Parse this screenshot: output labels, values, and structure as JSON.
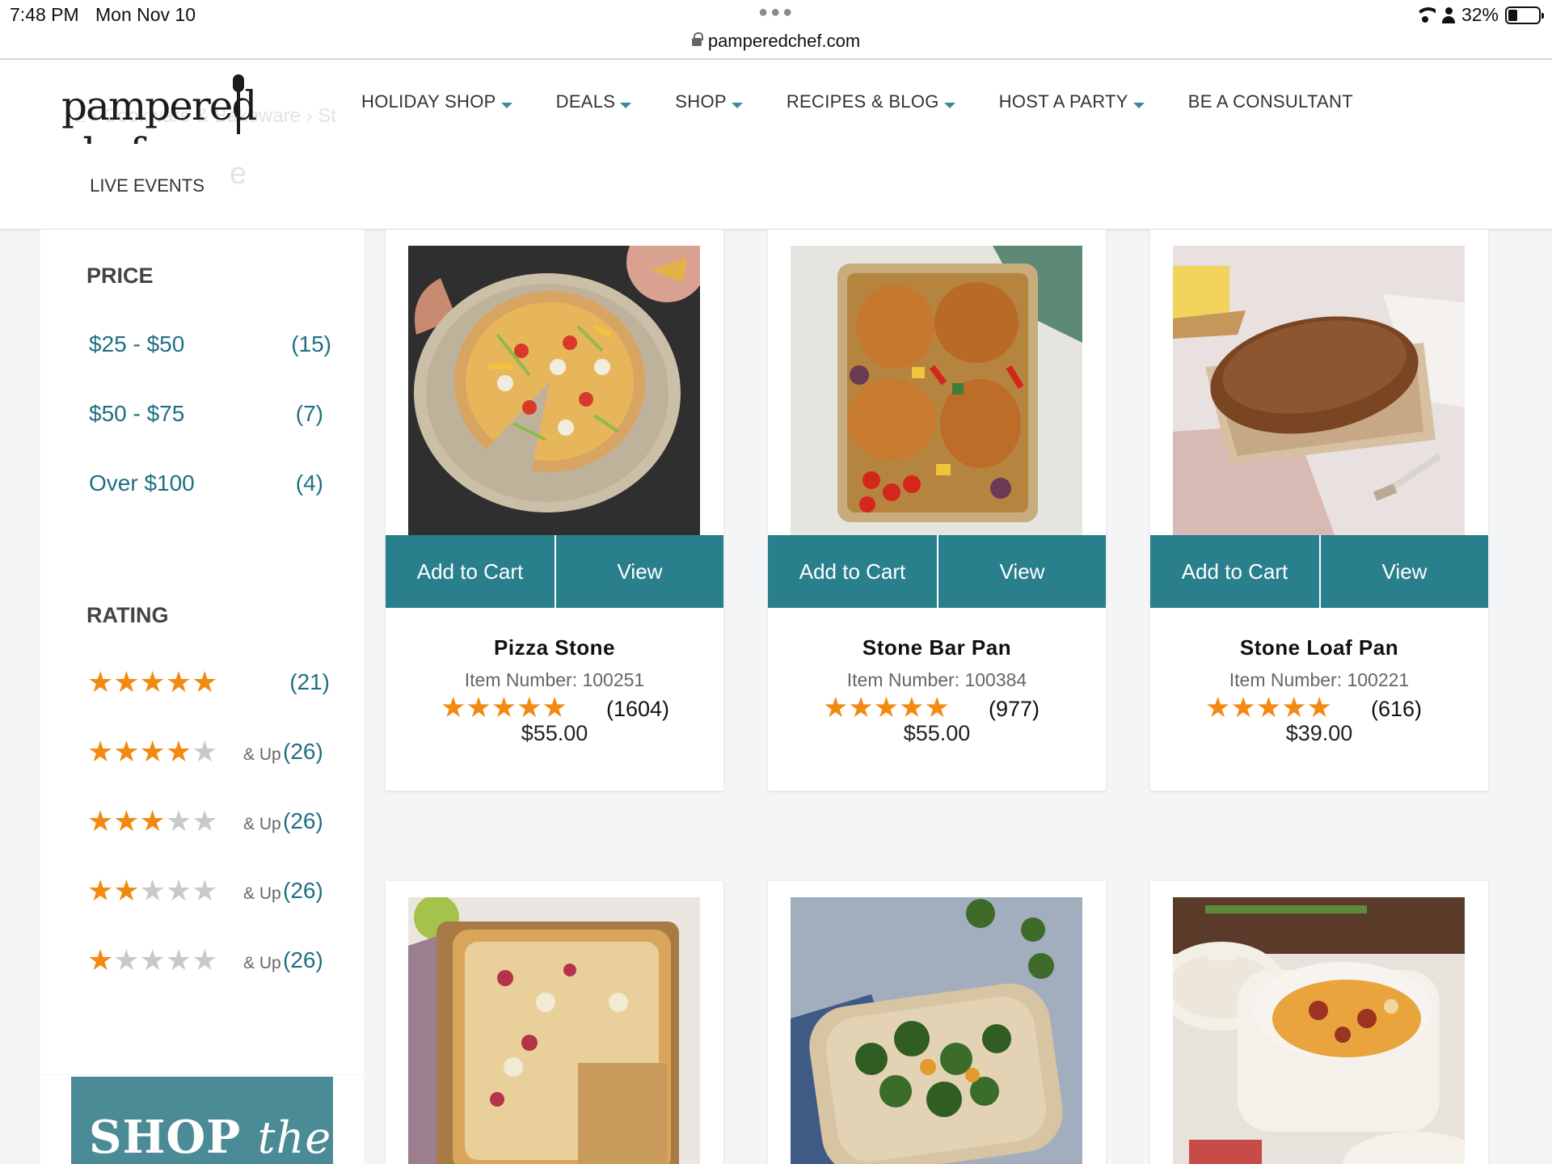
{
  "status_bar": {
    "time": "7:48 PM",
    "date": "Mon Nov 10",
    "url": "pamperedchef.com",
    "battery": "32%"
  },
  "header": {
    "ghost_breadcrumb": "⌂  ›  Cookware & Bakeware  ›  St",
    "ghost_title_fragment": "e",
    "logo_text_left": "pampered",
    "logo_text_right": "chef",
    "nav": [
      {
        "label": "HOLIDAY SHOP",
        "dropdown": true
      },
      {
        "label": "DEALS",
        "dropdown": true
      },
      {
        "label": "SHOP",
        "dropdown": true
      },
      {
        "label": "RECIPES & BLOG",
        "dropdown": true
      },
      {
        "label": "HOST A PARTY",
        "dropdown": true
      },
      {
        "label": "BE A CONSULTANT",
        "dropdown": false
      }
    ],
    "live_events": "LIVE EVENTS"
  },
  "filters": {
    "price_title": "PRICE",
    "price": [
      {
        "label": "$25 - $50",
        "count": "(15)"
      },
      {
        "label": "$50 - $75",
        "count": "(7)"
      },
      {
        "label": "Over $100",
        "count": "(4)"
      }
    ],
    "rating_title": "RATING",
    "rating": [
      {
        "stars": 5,
        "suffix": "",
        "count": "(21)"
      },
      {
        "stars": 4,
        "suffix": "& Up",
        "count": "(26)"
      },
      {
        "stars": 3,
        "suffix": "& Up",
        "count": "(26)"
      },
      {
        "stars": 2,
        "suffix": "& Up",
        "count": "(26)"
      },
      {
        "stars": 1,
        "suffix": "& Up",
        "count": "(26)"
      }
    ]
  },
  "banner": {
    "text_bold": "SHOP",
    "text_italic": "the"
  },
  "buttons": {
    "add_to_cart": "Add to Cart",
    "view": "View"
  },
  "products": [
    {
      "name": "Pizza Stone",
      "item_number": "Item Number: 100251",
      "rating": 5,
      "review_count": "(1604)",
      "price": "$55.00",
      "image": "pizza"
    },
    {
      "name": "Stone Bar Pan",
      "item_number": "Item Number: 100384",
      "rating": 5,
      "review_count": "(977)",
      "price": "$55.00",
      "image": "chicken"
    },
    {
      "name": "Stone Loaf Pan",
      "item_number": "Item Number: 100221",
      "rating": 5,
      "review_count": "(616)",
      "price": "$39.00",
      "image": "bread"
    },
    {
      "image": "flatbread"
    },
    {
      "image": "broccoli"
    },
    {
      "image": "casserole"
    }
  ],
  "colors": {
    "teal": "#2a7f8c",
    "link_teal": "#1f6f84",
    "star_orange": "#f28a12",
    "star_grey": "#c9c9c9"
  }
}
